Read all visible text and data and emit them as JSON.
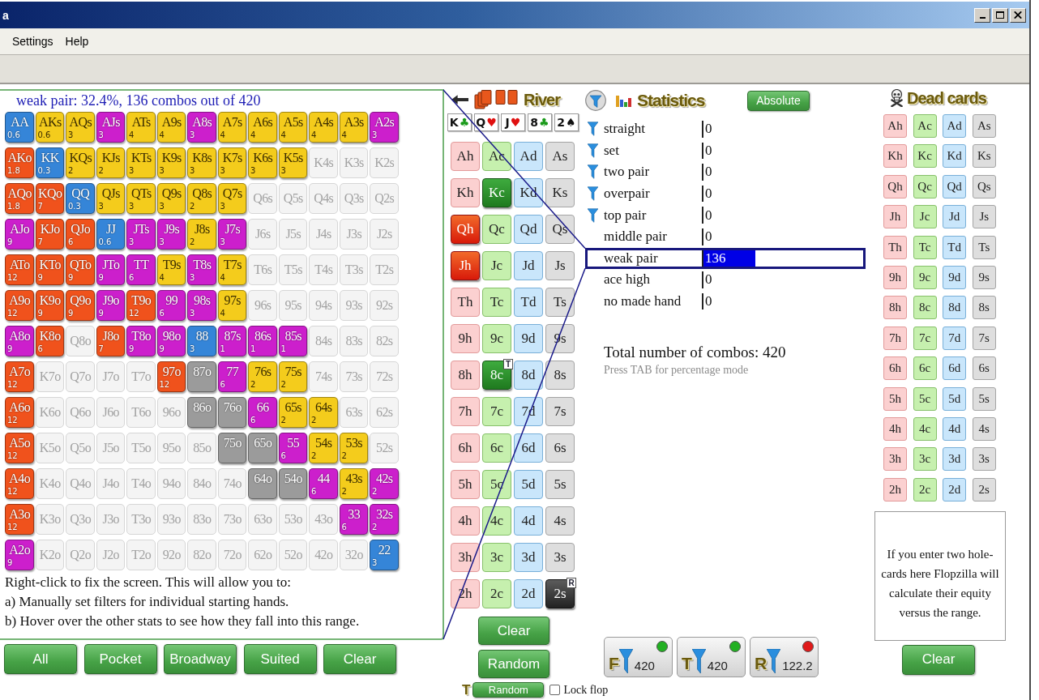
{
  "window": {
    "title": "a"
  },
  "menu": [
    "Settings",
    "Help"
  ],
  "hand_matrix": {
    "caption": "weak pair: 32.4%, 136 combos out of 420",
    "rows": [
      {
        "cells": [
          {
            "label": "AA",
            "count": "0.6",
            "color": "#3585d8"
          },
          {
            "label": "AKs",
            "count": "0.6",
            "color": "#f4cc1c"
          },
          {
            "label": "AQs",
            "count": "3",
            "color": "#f4cc1c"
          },
          {
            "label": "AJs",
            "count": "3",
            "color": "#cc1fcc"
          },
          {
            "label": "ATs",
            "count": "4",
            "color": "#f4cc1c"
          },
          {
            "label": "A9s",
            "count": "4",
            "color": "#f4cc1c"
          },
          {
            "label": "A8s",
            "count": "3",
            "color": "#cc1fcc"
          },
          {
            "label": "A7s",
            "count": "4",
            "color": "#f4cc1c"
          },
          {
            "label": "A6s",
            "count": "4",
            "color": "#f4cc1c"
          },
          {
            "label": "A5s",
            "count": "4",
            "color": "#f4cc1c"
          },
          {
            "label": "A4s",
            "count": "4",
            "color": "#f4cc1c"
          },
          {
            "label": "A3s",
            "count": "4",
            "color": "#f4cc1c"
          },
          {
            "label": "A2s",
            "count": "3",
            "color": "#cc1fcc"
          }
        ]
      },
      {
        "cells": [
          {
            "label": "AKo",
            "count": "1.8",
            "color": "#f0521c"
          },
          {
            "label": "KK",
            "count": "0.3",
            "color": "#3585d8"
          },
          {
            "label": "KQs",
            "count": "2",
            "color": "#f4cc1c"
          },
          {
            "label": "KJs",
            "count": "2",
            "color": "#f4cc1c"
          },
          {
            "label": "KTs",
            "count": "3",
            "color": "#f4cc1c"
          },
          {
            "label": "K9s",
            "count": "3",
            "color": "#f4cc1c"
          },
          {
            "label": "K8s",
            "count": "3",
            "color": "#f4cc1c"
          },
          {
            "label": "K7s",
            "count": "3",
            "color": "#f4cc1c"
          },
          {
            "label": "K6s",
            "count": "3",
            "color": "#f4cc1c"
          },
          {
            "label": "K5s",
            "count": "3",
            "color": "#f4cc1c"
          },
          {
            "label": "K4s"
          },
          {
            "label": "K3s"
          },
          {
            "label": "K2s"
          }
        ]
      },
      {
        "cells": [
          {
            "label": "AQo",
            "count": "1.8",
            "color": "#f0521c"
          },
          {
            "label": "KQo",
            "count": "7",
            "color": "#f0521c"
          },
          {
            "label": "QQ",
            "count": "0.3",
            "color": "#3585d8"
          },
          {
            "label": "QJs",
            "count": "3",
            "color": "#f4cc1c"
          },
          {
            "label": "QTs",
            "count": "3",
            "color": "#f4cc1c"
          },
          {
            "label": "Q9s",
            "count": "3",
            "color": "#f4cc1c"
          },
          {
            "label": "Q8s",
            "count": "2",
            "color": "#f4cc1c"
          },
          {
            "label": "Q7s",
            "count": "3",
            "color": "#f4cc1c"
          },
          {
            "label": "Q6s"
          },
          {
            "label": "Q5s"
          },
          {
            "label": "Q4s"
          },
          {
            "label": "Q3s"
          },
          {
            "label": "Q2s"
          }
        ]
      },
      {
        "cells": [
          {
            "label": "AJo",
            "count": "9",
            "color": "#cc1fcc"
          },
          {
            "label": "KJo",
            "count": "7",
            "color": "#f0521c"
          },
          {
            "label": "QJo",
            "count": "6",
            "color": "#f0521c"
          },
          {
            "label": "JJ",
            "count": "0.6",
            "color": "#3585d8"
          },
          {
            "label": "JTs",
            "count": "3",
            "color": "#cc1fcc"
          },
          {
            "label": "J9s",
            "count": "3",
            "color": "#cc1fcc"
          },
          {
            "label": "J8s",
            "count": "2",
            "color": "#f4cc1c"
          },
          {
            "label": "J7s",
            "count": "3",
            "color": "#cc1fcc"
          },
          {
            "label": "J6s"
          },
          {
            "label": "J5s"
          },
          {
            "label": "J4s"
          },
          {
            "label": "J3s"
          },
          {
            "label": "J2s"
          }
        ]
      },
      {
        "cells": [
          {
            "label": "ATo",
            "count": "12",
            "color": "#f0521c"
          },
          {
            "label": "KTo",
            "count": "9",
            "color": "#f0521c"
          },
          {
            "label": "QTo",
            "count": "9",
            "color": "#f0521c"
          },
          {
            "label": "JTo",
            "count": "9",
            "color": "#cc1fcc"
          },
          {
            "label": "TT",
            "count": "6",
            "color": "#cc1fcc"
          },
          {
            "label": "T9s",
            "count": "4",
            "color": "#f4cc1c"
          },
          {
            "label": "T8s",
            "count": "3",
            "color": "#cc1fcc"
          },
          {
            "label": "T7s",
            "count": "4",
            "color": "#f4cc1c"
          },
          {
            "label": "T6s"
          },
          {
            "label": "T5s"
          },
          {
            "label": "T4s"
          },
          {
            "label": "T3s"
          },
          {
            "label": "T2s"
          }
        ]
      },
      {
        "cells": [
          {
            "label": "A9o",
            "count": "12",
            "color": "#f0521c"
          },
          {
            "label": "K9o",
            "count": "9",
            "color": "#f0521c"
          },
          {
            "label": "Q9o",
            "count": "9",
            "color": "#f0521c"
          },
          {
            "label": "J9o",
            "count": "9",
            "color": "#cc1fcc"
          },
          {
            "label": "T9o",
            "count": "12",
            "color": "#f0521c"
          },
          {
            "label": "99",
            "count": "6",
            "color": "#cc1fcc"
          },
          {
            "label": "98s",
            "count": "3",
            "color": "#cc1fcc"
          },
          {
            "label": "97s",
            "count": "4",
            "color": "#f4cc1c"
          },
          {
            "label": "96s"
          },
          {
            "label": "95s"
          },
          {
            "label": "94s"
          },
          {
            "label": "93s"
          },
          {
            "label": "92s"
          }
        ]
      },
      {
        "cells": [
          {
            "label": "A8o",
            "count": "9",
            "color": "#cc1fcc"
          },
          {
            "label": "K8o",
            "count": "6",
            "color": "#f0521c"
          },
          {
            "label": "Q8o"
          },
          {
            "label": "J8o",
            "count": "7",
            "color": "#f0521c"
          },
          {
            "label": "T8o",
            "count": "9",
            "color": "#cc1fcc"
          },
          {
            "label": "98o",
            "count": "9",
            "color": "#cc1fcc"
          },
          {
            "label": "88",
            "count": "3",
            "color": "#3585d8"
          },
          {
            "label": "87s",
            "count": "1",
            "color": "#cc1fcc"
          },
          {
            "label": "86s",
            "count": "1",
            "color": "#cc1fcc"
          },
          {
            "label": "85s",
            "count": "1",
            "color": "#cc1fcc"
          },
          {
            "label": "84s"
          },
          {
            "label": "83s"
          },
          {
            "label": "82s"
          }
        ]
      },
      {
        "cells": [
          {
            "label": "A7o",
            "count": "12",
            "color": "#f0521c"
          },
          {
            "label": "K7o"
          },
          {
            "label": "Q7o"
          },
          {
            "label": "J7o"
          },
          {
            "label": "T7o"
          },
          {
            "label": "97o",
            "count": "12",
            "color": "#f0521c"
          },
          {
            "label": "87o",
            "color": "#9b9b9b"
          },
          {
            "label": "77",
            "count": "6",
            "color": "#cc1fcc"
          },
          {
            "label": "76s",
            "count": "2",
            "color": "#f4cc1c"
          },
          {
            "label": "75s",
            "count": "2",
            "color": "#f4cc1c"
          },
          {
            "label": "74s"
          },
          {
            "label": "73s"
          },
          {
            "label": "72s"
          }
        ]
      },
      {
        "cells": [
          {
            "label": "A6o",
            "count": "12",
            "color": "#f0521c"
          },
          {
            "label": "K6o"
          },
          {
            "label": "Q6o"
          },
          {
            "label": "J6o"
          },
          {
            "label": "T6o"
          },
          {
            "label": "96o"
          },
          {
            "label": "86o",
            "color": "#9b9b9b"
          },
          {
            "label": "76o",
            "color": "#9b9b9b"
          },
          {
            "label": "66",
            "count": "6",
            "color": "#cc1fcc"
          },
          {
            "label": "65s",
            "count": "2",
            "color": "#f4cc1c"
          },
          {
            "label": "64s",
            "count": "2",
            "color": "#f4cc1c"
          },
          {
            "label": "63s"
          },
          {
            "label": "62s"
          }
        ]
      },
      {
        "cells": [
          {
            "label": "A5o",
            "count": "12",
            "color": "#f0521c"
          },
          {
            "label": "K5o"
          },
          {
            "label": "Q5o"
          },
          {
            "label": "J5o"
          },
          {
            "label": "T5o"
          },
          {
            "label": "95o"
          },
          {
            "label": "85o"
          },
          {
            "label": "75o",
            "color": "#9b9b9b"
          },
          {
            "label": "65o",
            "color": "#9b9b9b"
          },
          {
            "label": "55",
            "count": "6",
            "color": "#cc1fcc"
          },
          {
            "label": "54s",
            "count": "2",
            "color": "#f4cc1c"
          },
          {
            "label": "53s",
            "count": "2",
            "color": "#f4cc1c"
          },
          {
            "label": "52s"
          }
        ]
      },
      {
        "cells": [
          {
            "label": "A4o",
            "count": "12",
            "color": "#f0521c"
          },
          {
            "label": "K4o"
          },
          {
            "label": "Q4o"
          },
          {
            "label": "J4o"
          },
          {
            "label": "T4o"
          },
          {
            "label": "94o"
          },
          {
            "label": "84o"
          },
          {
            "label": "74o"
          },
          {
            "label": "64o",
            "color": "#9b9b9b"
          },
          {
            "label": "54o",
            "color": "#9b9b9b"
          },
          {
            "label": "44",
            "count": "6",
            "color": "#cc1fcc"
          },
          {
            "label": "43s",
            "count": "2",
            "color": "#f4cc1c"
          },
          {
            "label": "42s",
            "count": "2",
            "color": "#cc1fcc"
          }
        ]
      },
      {
        "cells": [
          {
            "label": "A3o",
            "count": "12",
            "color": "#f0521c"
          },
          {
            "label": "K3o"
          },
          {
            "label": "Q3o"
          },
          {
            "label": "J3o"
          },
          {
            "label": "T3o"
          },
          {
            "label": "93o"
          },
          {
            "label": "83o"
          },
          {
            "label": "73o"
          },
          {
            "label": "63o"
          },
          {
            "label": "53o"
          },
          {
            "label": "43o"
          },
          {
            "label": "33",
            "count": "6",
            "color": "#cc1fcc"
          },
          {
            "label": "32s",
            "count": "2",
            "color": "#cc1fcc"
          }
        ]
      },
      {
        "cells": [
          {
            "label": "A2o",
            "count": "9",
            "color": "#cc1fcc"
          },
          {
            "label": "K2o"
          },
          {
            "label": "Q2o"
          },
          {
            "label": "J2o"
          },
          {
            "label": "T2o"
          },
          {
            "label": "92o"
          },
          {
            "label": "82o"
          },
          {
            "label": "72o"
          },
          {
            "label": "62o"
          },
          {
            "label": "52o"
          },
          {
            "label": "42o"
          },
          {
            "label": "32o"
          },
          {
            "label": "22",
            "count": "3",
            "color": "#3585d8"
          }
        ]
      }
    ]
  },
  "range_note": [
    "Right-click to fix the screen. This will allow you to:",
    "a) Manually set filters for individual starting hands.",
    "b) Hover over the other stats to see how they fall into this range."
  ],
  "range_buttons": [
    "All",
    "Pocket",
    "Broadway",
    "Suited",
    "Clear"
  ],
  "board": {
    "street": "River",
    "cards": [
      {
        "rank": "K",
        "suit": "♣",
        "kind": "clubs"
      },
      {
        "rank": "Q",
        "suit": "♥",
        "kind": "hearts"
      },
      {
        "rank": "J",
        "suit": "♥",
        "kind": "hearts"
      },
      {
        "rank": "8",
        "suit": "♣",
        "kind": "clubs"
      },
      {
        "rank": "2",
        "suit": "♠",
        "kind": "spades"
      }
    ]
  },
  "card_picker": {
    "rows": [
      {
        "cards": [
          {
            "label": "Ah",
            "kind": "hearts",
            "selected": false
          },
          {
            "label": "Ac",
            "kind": "clubs",
            "selected": false
          },
          {
            "label": "Ad",
            "kind": "diamonds",
            "selected": false
          },
          {
            "label": "As",
            "kind": "spades",
            "selected": false
          }
        ]
      },
      {
        "cards": [
          {
            "label": "Kh",
            "kind": "hearts",
            "selected": false
          },
          {
            "label": "Kc",
            "kind": "clubs",
            "selected": true
          },
          {
            "label": "Kd",
            "kind": "diamonds",
            "selected": false
          },
          {
            "label": "Ks",
            "kind": "spades",
            "selected": false
          }
        ]
      },
      {
        "cards": [
          {
            "label": "Qh",
            "kind": "hearts",
            "selected": true
          },
          {
            "label": "Qc",
            "kind": "clubs",
            "selected": false
          },
          {
            "label": "Qd",
            "kind": "diamonds",
            "selected": false
          },
          {
            "label": "Qs",
            "kind": "spades",
            "selected": false
          }
        ]
      },
      {
        "cards": [
          {
            "label": "Jh",
            "kind": "hearts",
            "selected": true
          },
          {
            "label": "Jc",
            "kind": "clubs",
            "selected": false
          },
          {
            "label": "Jd",
            "kind": "diamonds",
            "selected": false
          },
          {
            "label": "Js",
            "kind": "spades",
            "selected": false
          }
        ]
      },
      {
        "cards": [
          {
            "label": "Th",
            "kind": "hearts",
            "selected": false
          },
          {
            "label": "Tc",
            "kind": "clubs",
            "selected": false
          },
          {
            "label": "Td",
            "kind": "diamonds",
            "selected": false
          },
          {
            "label": "Ts",
            "kind": "spades",
            "selected": false
          }
        ]
      },
      {
        "cards": [
          {
            "label": "9h",
            "kind": "hearts",
            "selected": false
          },
          {
            "label": "9c",
            "kind": "clubs",
            "selected": false
          },
          {
            "label": "9d",
            "kind": "diamonds",
            "selected": false
          },
          {
            "label": "9s",
            "kind": "spades",
            "selected": false
          }
        ]
      },
      {
        "cards": [
          {
            "label": "8h",
            "kind": "hearts",
            "selected": false
          },
          {
            "label": "8c",
            "kind": "clubs",
            "selected": true,
            "badge": "T"
          },
          {
            "label": "8d",
            "kind": "diamonds",
            "selected": false
          },
          {
            "label": "8s",
            "kind": "spades",
            "selected": false
          }
        ]
      },
      {
        "cards": [
          {
            "label": "7h",
            "kind": "hearts",
            "selected": false
          },
          {
            "label": "7c",
            "kind": "clubs",
            "selected": false
          },
          {
            "label": "7d",
            "kind": "diamonds",
            "selected": false
          },
          {
            "label": "7s",
            "kind": "spades",
            "selected": false
          }
        ]
      },
      {
        "cards": [
          {
            "label": "6h",
            "kind": "hearts",
            "selected": false
          },
          {
            "label": "6c",
            "kind": "clubs",
            "selected": false
          },
          {
            "label": "6d",
            "kind": "diamonds",
            "selected": false
          },
          {
            "label": "6s",
            "kind": "spades",
            "selected": false
          }
        ]
      },
      {
        "cards": [
          {
            "label": "5h",
            "kind": "hearts",
            "selected": false
          },
          {
            "label": "5c",
            "kind": "clubs",
            "selected": false
          },
          {
            "label": "5d",
            "kind": "diamonds",
            "selected": false
          },
          {
            "label": "5s",
            "kind": "spades",
            "selected": false
          }
        ]
      },
      {
        "cards": [
          {
            "label": "4h",
            "kind": "hearts",
            "selected": false
          },
          {
            "label": "4c",
            "kind": "clubs",
            "selected": false
          },
          {
            "label": "4d",
            "kind": "diamonds",
            "selected": false
          },
          {
            "label": "4s",
            "kind": "spades",
            "selected": false
          }
        ]
      },
      {
        "cards": [
          {
            "label": "3h",
            "kind": "hearts",
            "selected": false
          },
          {
            "label": "3c",
            "kind": "clubs",
            "selected": false
          },
          {
            "label": "3d",
            "kind": "diamonds",
            "selected": false
          },
          {
            "label": "3s",
            "kind": "spades",
            "selected": false
          }
        ]
      },
      {
        "cards": [
          {
            "label": "2h",
            "kind": "hearts",
            "selected": false
          },
          {
            "label": "2c",
            "kind": "clubs",
            "selected": false
          },
          {
            "label": "2d",
            "kind": "diamonds",
            "selected": false
          },
          {
            "label": "2s",
            "kind": "spades",
            "selected": true,
            "badge": "R"
          }
        ]
      }
    ],
    "buttons": [
      "Clear",
      "Random"
    ]
  },
  "turn_random": {
    "letter": "T",
    "button": "Random"
  },
  "lock_flop": {
    "label": "Lock flop",
    "checked": false
  },
  "statistics": {
    "title": "Statistics",
    "mode_button": "Absolute",
    "rows": [
      {
        "label": "straight",
        "value": "0",
        "filter": true,
        "selected": false
      },
      {
        "label": "set",
        "value": "0",
        "filter": true,
        "selected": false
      },
      {
        "label": "two pair",
        "value": "0",
        "filter": true,
        "selected": false
      },
      {
        "label": "overpair",
        "value": "0",
        "filter": true,
        "selected": false
      },
      {
        "label": "top pair",
        "value": "0",
        "filter": true,
        "selected": false
      },
      {
        "label": "middle pair",
        "value": "0",
        "filter": false,
        "selected": false
      },
      {
        "label": "weak pair",
        "value": "136",
        "filter": false,
        "selected": true,
        "level": 0.324
      },
      {
        "label": "ace high",
        "value": "0",
        "filter": false,
        "selected": false
      },
      {
        "label": "no made hand",
        "value": "0",
        "filter": false,
        "selected": false
      }
    ],
    "total": "Total number of combos: 420",
    "hint": "Press TAB for percentage mode"
  },
  "filter_buttons": [
    {
      "letter": "F",
      "value": "420",
      "color": "#22b022"
    },
    {
      "letter": "T",
      "value": "420",
      "color": "#22b022"
    },
    {
      "letter": "R",
      "value": "122.2",
      "color": "#e01a1a"
    }
  ],
  "dead_cards": {
    "title": "Dead cards",
    "rows": [
      {
        "cards": [
          {
            "label": "Ah",
            "kind": "hearts"
          },
          {
            "label": "Ac",
            "kind": "clubs"
          },
          {
            "label": "Ad",
            "kind": "diamonds"
          },
          {
            "label": "As",
            "kind": "spades"
          }
        ]
      },
      {
        "cards": [
          {
            "label": "Kh",
            "kind": "hearts"
          },
          {
            "label": "Kc",
            "kind": "clubs"
          },
          {
            "label": "Kd",
            "kind": "diamonds"
          },
          {
            "label": "Ks",
            "kind": "spades"
          }
        ]
      },
      {
        "cards": [
          {
            "label": "Qh",
            "kind": "hearts"
          },
          {
            "label": "Qc",
            "kind": "clubs"
          },
          {
            "label": "Qd",
            "kind": "diamonds"
          },
          {
            "label": "Qs",
            "kind": "spades"
          }
        ]
      },
      {
        "cards": [
          {
            "label": "Jh",
            "kind": "hearts"
          },
          {
            "label": "Jc",
            "kind": "clubs"
          },
          {
            "label": "Jd",
            "kind": "diamonds"
          },
          {
            "label": "Js",
            "kind": "spades"
          }
        ]
      },
      {
        "cards": [
          {
            "label": "Th",
            "kind": "hearts"
          },
          {
            "label": "Tc",
            "kind": "clubs"
          },
          {
            "label": "Td",
            "kind": "diamonds"
          },
          {
            "label": "Ts",
            "kind": "spades"
          }
        ]
      },
      {
        "cards": [
          {
            "label": "9h",
            "kind": "hearts"
          },
          {
            "label": "9c",
            "kind": "clubs"
          },
          {
            "label": "9d",
            "kind": "diamonds"
          },
          {
            "label": "9s",
            "kind": "spades"
          }
        ]
      },
      {
        "cards": [
          {
            "label": "8h",
            "kind": "hearts"
          },
          {
            "label": "8c",
            "kind": "clubs"
          },
          {
            "label": "8d",
            "kind": "diamonds"
          },
          {
            "label": "8s",
            "kind": "spades"
          }
        ]
      },
      {
        "cards": [
          {
            "label": "7h",
            "kind": "hearts"
          },
          {
            "label": "7c",
            "kind": "clubs"
          },
          {
            "label": "7d",
            "kind": "diamonds"
          },
          {
            "label": "7s",
            "kind": "spades"
          }
        ]
      },
      {
        "cards": [
          {
            "label": "6h",
            "kind": "hearts"
          },
          {
            "label": "6c",
            "kind": "clubs"
          },
          {
            "label": "6d",
            "kind": "diamonds"
          },
          {
            "label": "6s",
            "kind": "spades"
          }
        ]
      },
      {
        "cards": [
          {
            "label": "5h",
            "kind": "hearts"
          },
          {
            "label": "5c",
            "kind": "clubs"
          },
          {
            "label": "5d",
            "kind": "diamonds"
          },
          {
            "label": "5s",
            "kind": "spades"
          }
        ]
      },
      {
        "cards": [
          {
            "label": "4h",
            "kind": "hearts"
          },
          {
            "label": "4c",
            "kind": "clubs"
          },
          {
            "label": "4d",
            "kind": "diamonds"
          },
          {
            "label": "4s",
            "kind": "spades"
          }
        ]
      },
      {
        "cards": [
          {
            "label": "3h",
            "kind": "hearts"
          },
          {
            "label": "3c",
            "kind": "clubs"
          },
          {
            "label": "3d",
            "kind": "diamonds"
          },
          {
            "label": "3s",
            "kind": "spades"
          }
        ]
      },
      {
        "cards": [
          {
            "label": "2h",
            "kind": "hearts"
          },
          {
            "label": "2c",
            "kind": "clubs"
          },
          {
            "label": "2d",
            "kind": "diamonds"
          },
          {
            "label": "2s",
            "kind": "spades"
          }
        ]
      }
    ],
    "hole_cards": {
      "placeholder": "If you enter two hole-cards here Flopzilla will calculate their equity versus the range."
    },
    "clear_button": "Clear"
  }
}
